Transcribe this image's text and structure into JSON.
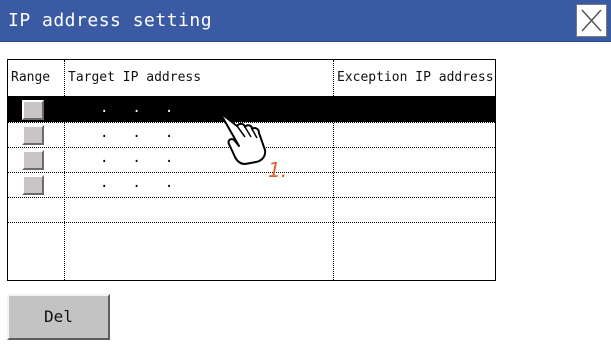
{
  "window": {
    "title": "IP address setting",
    "close_icon": "close-x-icon",
    "titlebar_color": "#3a5ba3"
  },
  "table": {
    "headers": {
      "range": "Range",
      "target": "Target IP address",
      "exception": "Exception IP address"
    },
    "rows": [
      {
        "target_ip": "...",
        "exception_ip": "",
        "selected": true,
        "has_range_checkbox": true
      },
      {
        "target_ip": "...",
        "exception_ip": "",
        "selected": false,
        "has_range_checkbox": true
      },
      {
        "target_ip": "...",
        "exception_ip": "",
        "selected": false,
        "has_range_checkbox": true
      },
      {
        "target_ip": "...",
        "exception_ip": "",
        "selected": false,
        "has_range_checkbox": true
      },
      {
        "target_ip": "",
        "exception_ip": "",
        "selected": false,
        "has_range_checkbox": false
      },
      {
        "target_ip": "",
        "exception_ip": "",
        "selected": false,
        "has_range_checkbox": false
      }
    ]
  },
  "annotation": {
    "step": "1.",
    "icon": "pointing-hand-icon",
    "color": "#e0602a"
  },
  "buttons": {
    "delete_label": "Del"
  }
}
